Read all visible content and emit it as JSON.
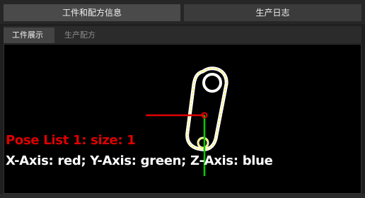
{
  "top_tabs": [
    {
      "label": "工件和配方信息",
      "active": true
    },
    {
      "label": "生产日志",
      "active": false
    }
  ],
  "sub_tabs": [
    {
      "label": "工件展示",
      "active": true
    },
    {
      "label": "生产配方",
      "active": false
    }
  ],
  "viewer": {
    "pose_text": "Pose List 1: size: 1",
    "axis_legend": "X-Axis: red; Y-Axis: green; Z-Axis: blue",
    "colors": {
      "x_axis": "#e00000",
      "y_axis": "#00cc00",
      "part_outline": "#ffffff",
      "contour": "#f2e600"
    }
  }
}
